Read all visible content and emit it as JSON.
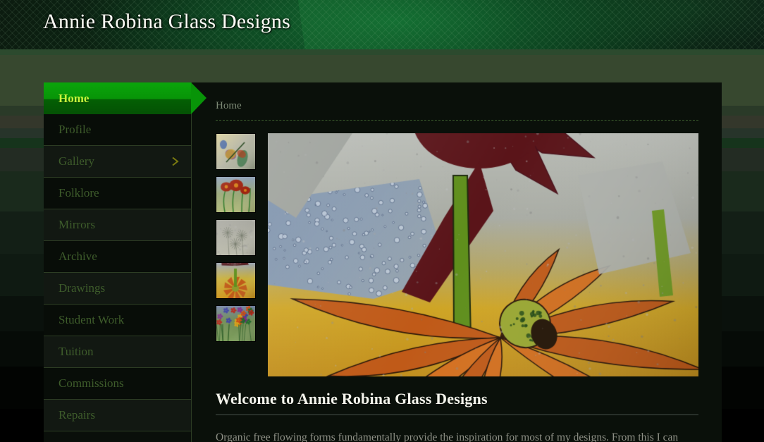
{
  "header": {
    "site_title": "Annie Robina Glass Designs"
  },
  "sidebar": {
    "items": [
      {
        "label": "Home",
        "active": true,
        "has_chevron": false
      },
      {
        "label": "Profile",
        "active": false,
        "has_chevron": false
      },
      {
        "label": "Gallery",
        "active": false,
        "has_chevron": true
      },
      {
        "label": "Folklore",
        "active": false,
        "has_chevron": false
      },
      {
        "label": "Mirrors",
        "active": false,
        "has_chevron": false
      },
      {
        "label": "Archive",
        "active": false,
        "has_chevron": false
      },
      {
        "label": "Drawings",
        "active": false,
        "has_chevron": false
      },
      {
        "label": "Student Work",
        "active": false,
        "has_chevron": false
      },
      {
        "label": "Tuition",
        "active": false,
        "has_chevron": false
      },
      {
        "label": "Commissions",
        "active": false,
        "has_chevron": false
      },
      {
        "label": "Repairs",
        "active": false,
        "has_chevron": false
      }
    ]
  },
  "content": {
    "breadcrumb": "Home",
    "heading": "Welcome to Annie Robina Glass Designs",
    "paragraph": "Organic free flowing forms fundamentally provide the inspiration for most of my designs. From this I can",
    "thumbnails": [
      {
        "name": "thumbnail-dragonfly-abstract"
      },
      {
        "name": "thumbnail-red-poppies"
      },
      {
        "name": "thumbnail-pale-dandelions"
      },
      {
        "name": "thumbnail-dragonfly-orange-flower"
      },
      {
        "name": "thumbnail-mixed-wildflowers"
      }
    ],
    "hero_image": {
      "name": "hero-fused-glass-flowers"
    }
  },
  "colors": {
    "header_green": "#0a2a13",
    "active_nav_green": "#089408",
    "active_nav_text": "#c8f53c",
    "nav_text": "#3e5c2b",
    "nav_border": "#2d3d24",
    "content_bg": "#0a100a",
    "heading_text": "#f4f4ec",
    "body_text": "#8d8f85",
    "breadcrumb_text": "#7d8a76",
    "band_green": "#436b45"
  }
}
